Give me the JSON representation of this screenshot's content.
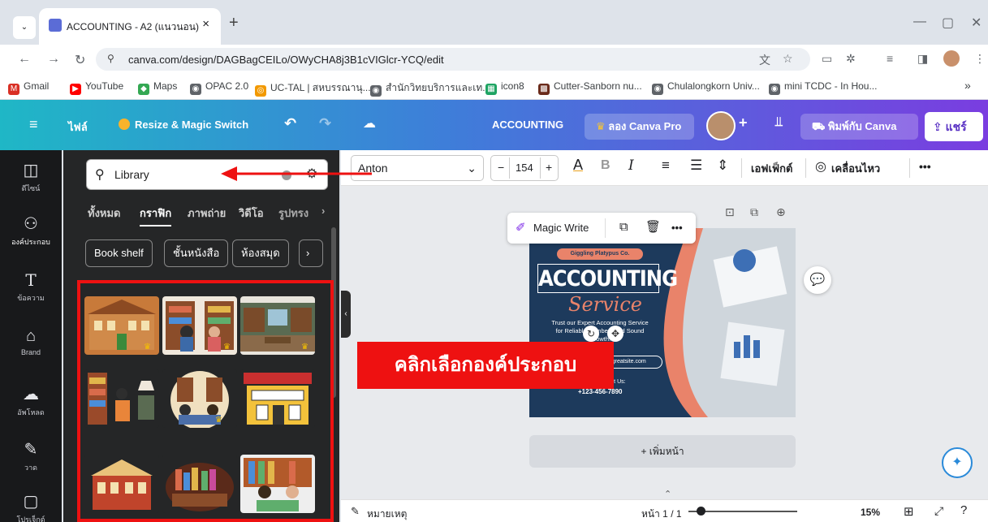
{
  "browser": {
    "tab_title": "ACCOUNTING - A2 (แนวนอน)",
    "close_glyph": "×",
    "new_tab_glyph": "+",
    "url": "canva.com/design/DAGBagCEILo/OWyCHA8j3B1cVIGlcr-YCQ/edit",
    "bookmarks": [
      "Gmail",
      "YouTube",
      "Maps",
      "OPAC 2.0",
      "UC-TAL | สหบรรณานุ...",
      "สำนักวิทยบริการและเท...",
      "icon8",
      "Cutter-Sanborn nu...",
      "Chulalongkorn Univ...",
      "mini TCDC - In Hou..."
    ],
    "more_bookmarks": "»"
  },
  "header": {
    "menu_icon": "hamburger-icon",
    "file": "ไฟล์",
    "resize": "Resize & Magic Switch",
    "doc_title": "ACCOUNTING",
    "try_pro": "ลอง Canva Pro",
    "add": "+",
    "print": "พิมพ์กับ Canva",
    "share": "แชร์"
  },
  "rail": [
    {
      "icon": "layout-icon",
      "glyph": "◫",
      "label": "ดีไซน์"
    },
    {
      "icon": "elements-icon",
      "glyph": "⚇",
      "label": "องค์ประกอบ"
    },
    {
      "icon": "text-icon",
      "glyph": "T",
      "label": "ข้อความ"
    },
    {
      "icon": "brand-icon",
      "glyph": "⌂",
      "label": "Brand"
    },
    {
      "icon": "upload-icon",
      "glyph": "☁",
      "label": "อัพโหลด"
    },
    {
      "icon": "draw-icon",
      "glyph": "✎",
      "label": "วาด"
    },
    {
      "icon": "projects-icon",
      "glyph": "▢",
      "label": "โปรเจ็กต์"
    }
  ],
  "panel": {
    "search_value": "Library",
    "categories": [
      "ทั้งหมด",
      "กราฟิก",
      "ภาพถ่าย",
      "วิดีโอ",
      "รูปทรง"
    ],
    "active_category": "กราฟิก",
    "chips": [
      "Book shelf",
      "ชั้นหนังสือ",
      "ห้องสมุด"
    ],
    "chip_next": "›"
  },
  "toolbar": {
    "font": "Anton",
    "minus": "−",
    "size": "154",
    "plus": "+",
    "text_color": "A",
    "bold": "B",
    "italic": "I",
    "effects": "เอฟเฟ็กต์",
    "animate": "เคลื่อนไหว",
    "more": "•••"
  },
  "floatbar": {
    "magic_write": "Magic Write",
    "more": "•••"
  },
  "design": {
    "company": "Giggling Platypus Co.",
    "title": "ACCOUNTING",
    "subtitle": "Service",
    "body": "Trust our Expert Accounting Service for Reliable Numbers and Sound Growth.",
    "website": "www.reallygreatsite.com",
    "contact": "Contact Us:",
    "phone": "+123-456-7890"
  },
  "add_page": "+ เพิ่มหน้า",
  "annotation": {
    "callout": "คลิกเลือกองค์ประกอบ",
    "color": "#ee1111"
  },
  "footer": {
    "notes": "หมายเหตุ",
    "page": "หน้า 1 / 1",
    "zoom": "15%"
  },
  "colors": {
    "header_start": "#1fb7c6",
    "header_end": "#7a3de0",
    "rail": "#18191b",
    "panel": "#252627",
    "highlight": "#ee1111"
  }
}
